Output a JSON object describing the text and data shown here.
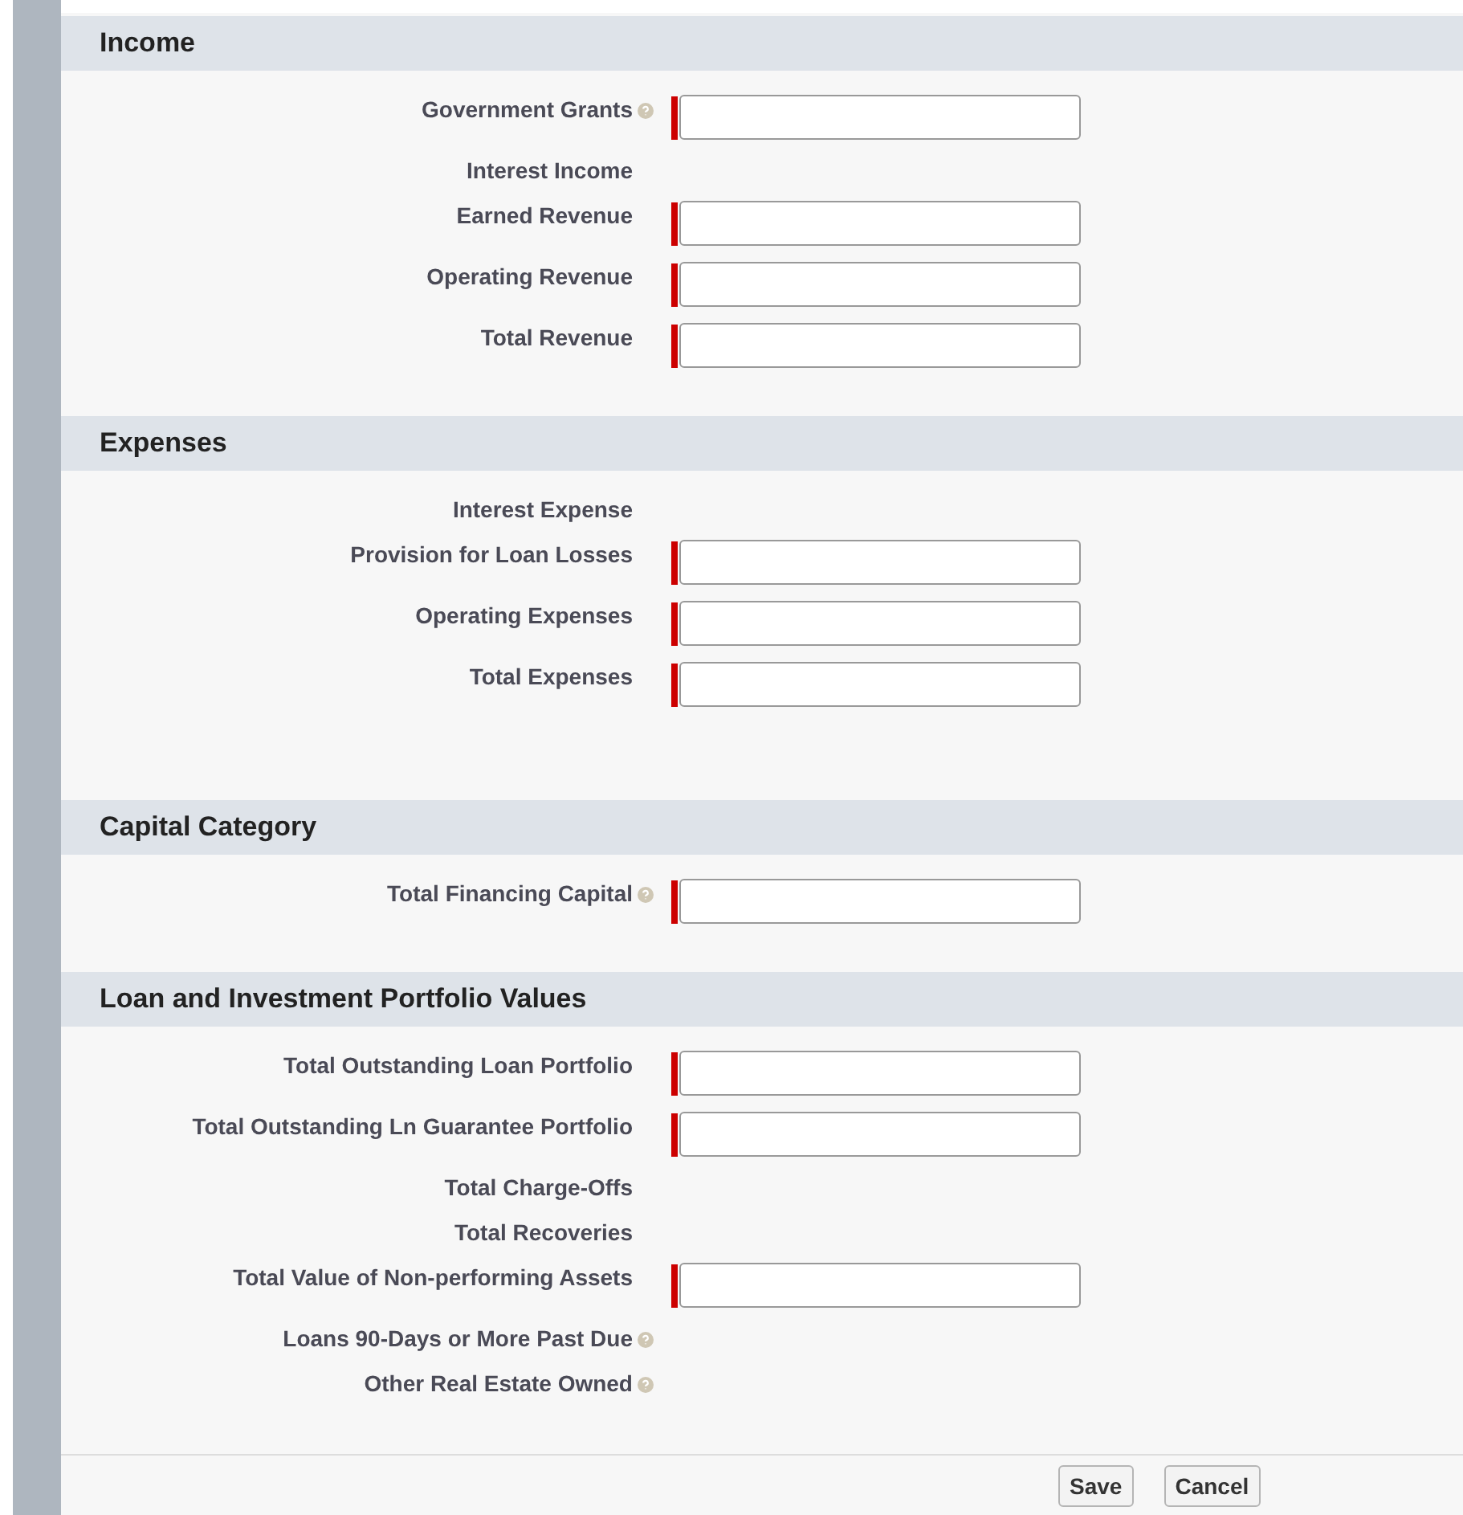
{
  "sections": [
    {
      "title": "Income",
      "fields": [
        {
          "label": "Government Grants",
          "help": true,
          "kind": "input"
        },
        {
          "label": "Interest Income",
          "help": false,
          "kind": "readonly"
        },
        {
          "label": "Earned Revenue",
          "help": false,
          "kind": "input"
        },
        {
          "label": "Operating Revenue",
          "help": false,
          "kind": "input"
        },
        {
          "label": "Total Revenue",
          "help": false,
          "kind": "input"
        }
      ]
    },
    {
      "title": "Expenses",
      "fields": [
        {
          "label": "Interest Expense",
          "help": false,
          "kind": "readonly"
        },
        {
          "label": "Provision for Loan Losses",
          "help": false,
          "kind": "input"
        },
        {
          "label": "Operating Expenses",
          "help": false,
          "kind": "input"
        },
        {
          "label": "Total Expenses",
          "help": false,
          "kind": "input"
        }
      ]
    },
    {
      "title": "Capital Category",
      "fields": [
        {
          "label": "Total Financing Capital",
          "help": true,
          "kind": "input"
        }
      ]
    },
    {
      "title": "Loan and Investment Portfolio Values",
      "fields": [
        {
          "label": "Total Outstanding Loan Portfolio",
          "help": false,
          "kind": "input"
        },
        {
          "label": "Total Outstanding Ln Guarantee Portfolio",
          "help": false,
          "kind": "input"
        },
        {
          "label": "Total Charge-Offs",
          "help": false,
          "kind": "readonly"
        },
        {
          "label": "Total Recoveries",
          "help": false,
          "kind": "readonly"
        },
        {
          "label": "Total Value of Non-performing Assets",
          "help": false,
          "kind": "input"
        },
        {
          "label": "Loans 90-Days or More Past Due",
          "help": true,
          "kind": "readonly"
        },
        {
          "label": "Other Real Estate Owned",
          "help": true,
          "kind": "readonly"
        }
      ]
    }
  ],
  "buttons": [
    "Save",
    "Cancel"
  ]
}
